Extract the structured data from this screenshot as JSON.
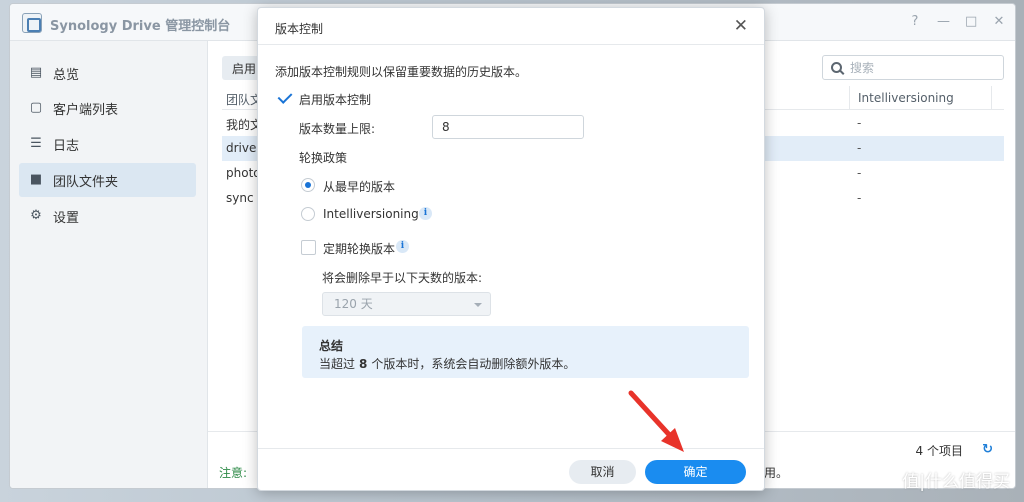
{
  "app": {
    "title": "Synology Drive 管理控制台",
    "win_controls": [
      "?",
      "—",
      "□",
      "✕"
    ]
  },
  "sidebar": {
    "items": [
      {
        "label": "总览",
        "icon": "overview-icon"
      },
      {
        "label": "客户端列表",
        "icon": "client-list-icon"
      },
      {
        "label": "日志",
        "icon": "log-icon"
      },
      {
        "label": "团队文件夹",
        "icon": "team-folder-icon",
        "active": true
      },
      {
        "label": "设置",
        "icon": "settings-gear-icon"
      }
    ]
  },
  "content": {
    "toolbar_button": "启用",
    "search_placeholder": "搜索",
    "columns": [
      "团队文",
      "Intelliversioning"
    ],
    "rows": [
      {
        "name": "我的文",
        "value": "-"
      },
      {
        "name": "drive",
        "value": "-",
        "selected": true
      },
      {
        "name": "photo",
        "value": "-"
      },
      {
        "name": "sync",
        "value": "-"
      }
    ],
    "count": "4 个项目",
    "note_label": "注意:",
    "note_tail": "用。"
  },
  "dialog": {
    "title": "版本控制",
    "description": "添加版本控制规则以保留重要数据的历史版本。",
    "enable_label": "启用版本控制",
    "enable_checked": true,
    "max_versions_label": "版本数量上限:",
    "max_versions_value": "8",
    "rotation_label": "轮换政策",
    "option_oldest": "从最早的版本",
    "option_intelli": "Intelliversioning",
    "selected_option": "oldest",
    "scheduled_label": "定期轮换版本",
    "scheduled_checked": false,
    "delete_days_label": "将会删除早于以下天数的版本:",
    "days_value": "120 天",
    "summary_title": "总结",
    "summary_prefix": "当超过",
    "summary_count": "8",
    "summary_suffix": "个版本时，系统会自动删除额外版本。",
    "cancel_label": "取消",
    "ok_label": "确定"
  },
  "watermark": "值|什么值得买",
  "colors": {
    "accent": "#1a8cf0",
    "arrow": "#e8332a",
    "selected_row": "#e2edf8",
    "summary_bg": "#e7f1fb"
  }
}
